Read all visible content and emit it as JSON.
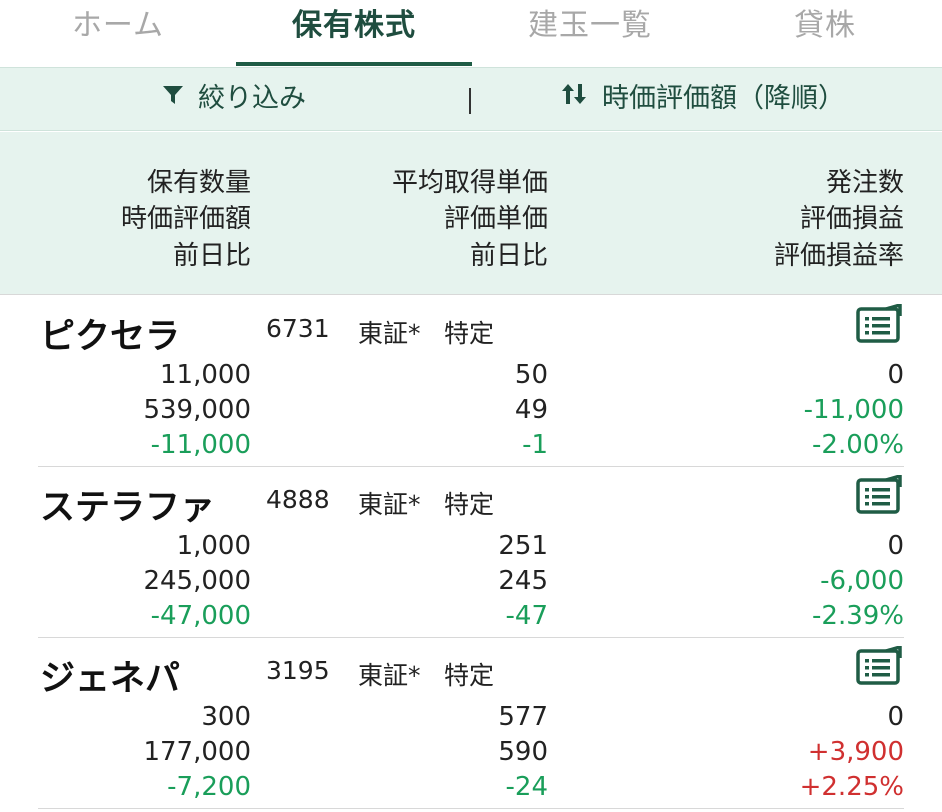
{
  "tabs": [
    {
      "label": "ホーム",
      "active": false
    },
    {
      "label": "保有株式",
      "active": true
    },
    {
      "label": "建玉一覧",
      "active": false
    },
    {
      "label": "貸株",
      "active": false
    }
  ],
  "toolbar": {
    "filter_icon": "filter-funnel-icon",
    "filter_label": "絞り込み",
    "sort_icon": "sort-arrows-icon",
    "sort_label": "時価評価額（降順）"
  },
  "column_headers": {
    "left": [
      "保有数量",
      "時価評価額",
      "前日比"
    ],
    "middle": [
      "平均取得単価",
      "評価単価",
      "前日比"
    ],
    "right": [
      "発注数",
      "評価損益",
      "評価損益率"
    ]
  },
  "colors": {
    "accent": "#1f5c45",
    "header_bg": "#e6f3ee",
    "negative": "#1a9e5a",
    "positive": "#d03030"
  },
  "holdings": [
    {
      "name": "ピクセラ",
      "code": "6731",
      "market": "東証*",
      "account": "特定",
      "order_icon": "order-list-icon",
      "quantity": "11,000",
      "market_value": "539,000",
      "day_change": "-11,000",
      "avg_price": "50",
      "eval_price": "49",
      "price_change": "-1",
      "order_count": "0",
      "pnl": "-11,000",
      "pnl_rate": "-2.00%"
    },
    {
      "name": "ステラファ",
      "code": "4888",
      "market": "東証*",
      "account": "特定",
      "order_icon": "order-list-icon",
      "quantity": "1,000",
      "market_value": "245,000",
      "day_change": "-47,000",
      "avg_price": "251",
      "eval_price": "245",
      "price_change": "-47",
      "order_count": "0",
      "pnl": "-6,000",
      "pnl_rate": "-2.39%"
    },
    {
      "name": "ジェネパ",
      "code": "3195",
      "market": "東証*",
      "account": "特定",
      "order_icon": "order-list-icon",
      "quantity": "300",
      "market_value": "177,000",
      "day_change": "-7,200",
      "avg_price": "577",
      "eval_price": "590",
      "price_change": "-24",
      "order_count": "0",
      "pnl": "+3,900",
      "pnl_rate": "+2.25%"
    }
  ]
}
